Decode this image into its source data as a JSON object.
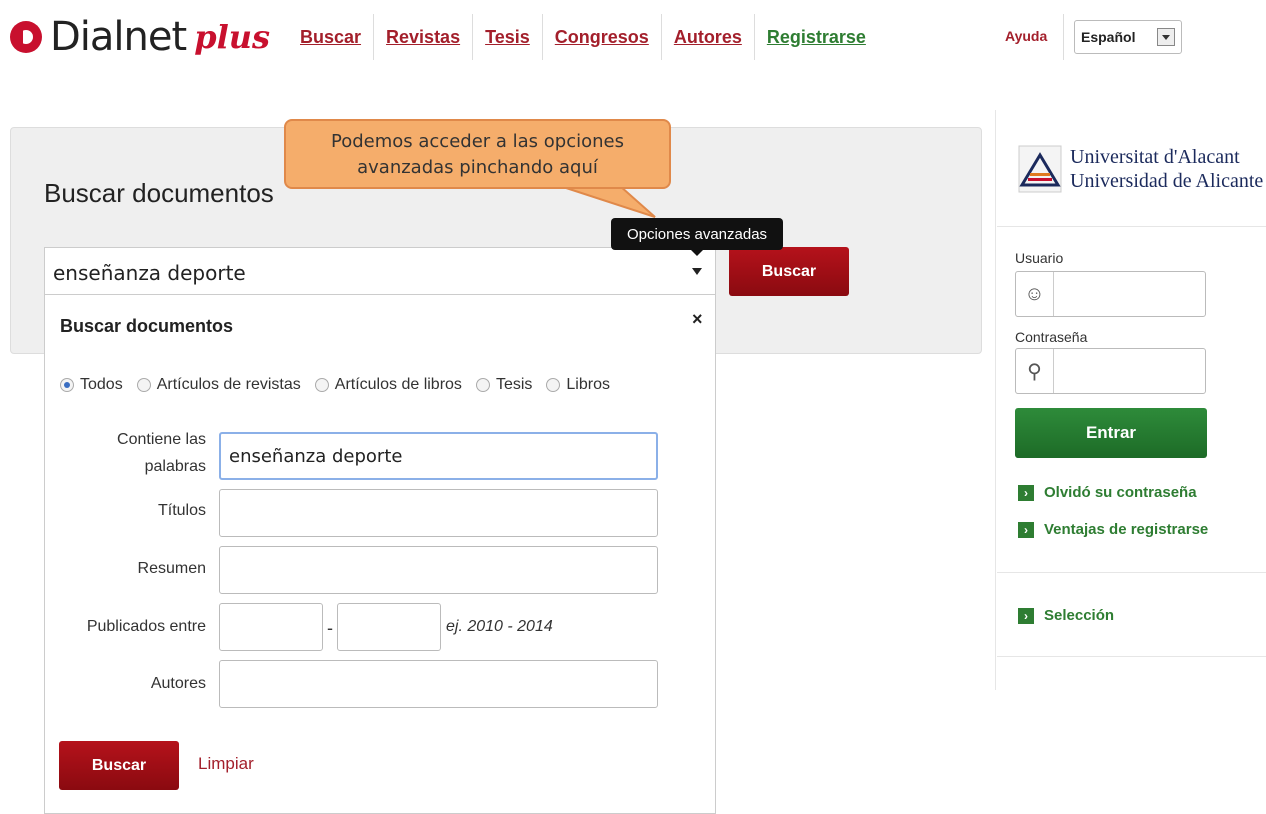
{
  "brand": {
    "name": "Dialnet",
    "plus": "plus"
  },
  "nav": [
    "Buscar",
    "Revistas",
    "Tesis",
    "Congresos",
    "Autores",
    "Registrarse"
  ],
  "header": {
    "help": "Ayuda",
    "language": "Español"
  },
  "search": {
    "title": "Buscar documentos",
    "query": "enseñanza deporte",
    "button": "Buscar",
    "tooltip": "Opciones avanzadas",
    "callout": "Podemos acceder a las opciones avanzadas pinchando aquí"
  },
  "advanced": {
    "title": "Buscar documentos",
    "close": "×",
    "types": [
      "Todos",
      "Artículos de revistas",
      "Artículos de libros",
      "Tesis",
      "Libros"
    ],
    "selected_type": "Todos",
    "labels": {
      "contains_line1": "Contiene las",
      "contains_line2": "palabras",
      "titles": "Títulos",
      "summary": "Resumen",
      "published": "Publicados entre",
      "authors": "Autores"
    },
    "contains_value": "enseñanza deporte",
    "dash": "-",
    "hint": "ej. 2010 - 2014",
    "search_button": "Buscar",
    "clear_link": "Limpiar"
  },
  "sidebar": {
    "university_line1": "Universitat d'Alacant",
    "university_line2": "Universidad de Alicante",
    "user_label": "Usuario",
    "password_label": "Contraseña",
    "enter_button": "Entrar",
    "links": [
      "Olvidó su contraseña",
      "Ventajas de registrarse"
    ],
    "selection": "Selección"
  },
  "colors": {
    "brand_red": "#c8102e",
    "nav_red": "#a31f2b",
    "green": "#2e7d32",
    "callout": "#f5ad6b"
  }
}
